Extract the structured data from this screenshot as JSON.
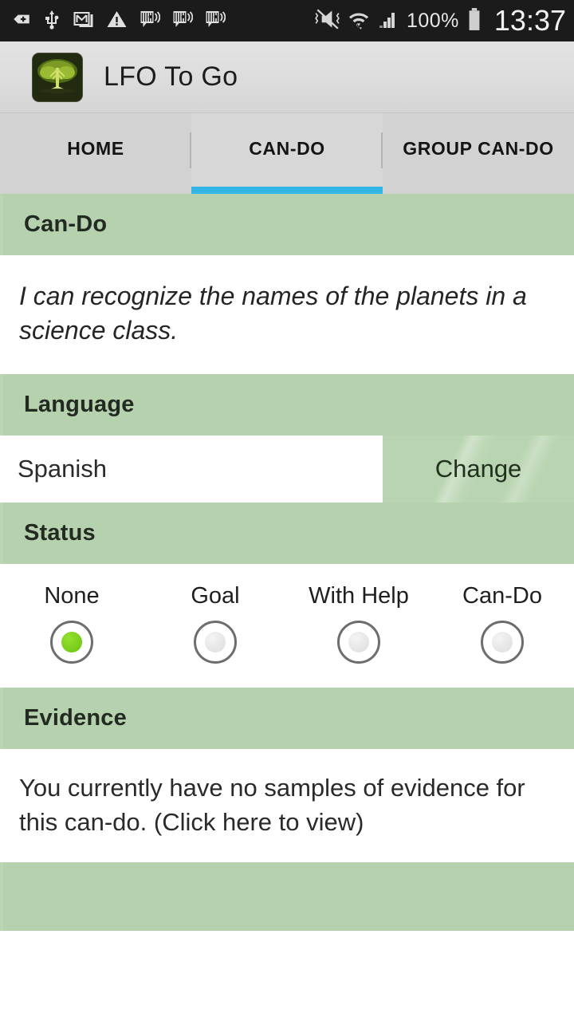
{
  "statusbar": {
    "icons_left": [
      "sim-add-icon",
      "usb-icon",
      "gmail-icon",
      "warning-icon",
      "voicemail-icon",
      "voicemail-icon",
      "voicemail-icon"
    ],
    "icons_right": [
      "mute-vibrate-icon",
      "wifi-icon",
      "signal-icon",
      "battery-icon"
    ],
    "battery_percent": "100%",
    "clock": "13:37"
  },
  "actionbar": {
    "app_icon": "tree-logo-icon",
    "title": "LFO To Go"
  },
  "tabs": [
    {
      "label": "HOME",
      "active": false
    },
    {
      "label": "CAN-DO",
      "active": true
    },
    {
      "label": "GROUP CAN-DO",
      "active": false
    }
  ],
  "sections": {
    "cando": {
      "header": "Can-Do",
      "text": "I can recognize the names of the planets in a science class."
    },
    "language": {
      "header": "Language",
      "value": "Spanish",
      "change_label": "Change"
    },
    "status": {
      "header": "Status",
      "options": [
        {
          "label": "None",
          "selected": true
        },
        {
          "label": "Goal",
          "selected": false
        },
        {
          "label": "With Help",
          "selected": false
        },
        {
          "label": "Can-Do",
          "selected": false
        }
      ]
    },
    "evidence": {
      "header": "Evidence",
      "text": "You currently have no samples of evidence for this can-do. (Click here to view)"
    }
  },
  "colors": {
    "accent_blue": "#33b5e5",
    "section_green": "#b8d4b0",
    "radio_selected_green": "#7ccc1f",
    "statusbar_bg": "#1b1b1b",
    "actionbar_bg": "#dadada"
  }
}
